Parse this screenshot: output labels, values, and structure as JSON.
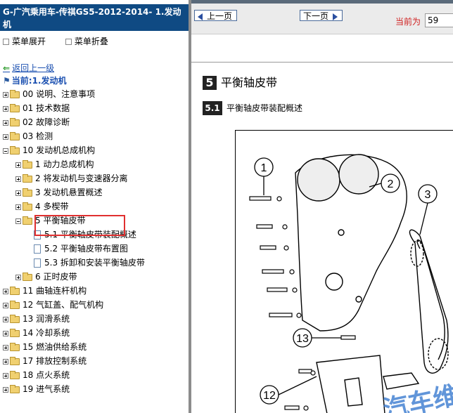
{
  "left_panel": {
    "title": "G-广汽乘用车-传祺GS5-2012-2014- 1.发动机",
    "menu_expand": "菜单展开",
    "menu_collapse": "菜单折叠",
    "back_link": "返回上一级",
    "current": "当前:1.发动机"
  },
  "tree": [
    {
      "label": "00 说明、注意事项",
      "level": 0,
      "type": "folder",
      "expanded": false
    },
    {
      "label": "01 技术数据",
      "level": 0,
      "type": "folder",
      "expanded": false
    },
    {
      "label": "02 故障诊断",
      "level": 0,
      "type": "folder",
      "expanded": false
    },
    {
      "label": "03 检测",
      "level": 0,
      "type": "folder",
      "expanded": false
    },
    {
      "label": "10 发动机总成机构",
      "level": 0,
      "type": "folder",
      "expanded": true
    },
    {
      "label": "1 动力总成机构",
      "level": 1,
      "type": "folder",
      "expanded": false
    },
    {
      "label": "2 将发动机与变速器分离",
      "level": 1,
      "type": "folder",
      "expanded": false
    },
    {
      "label": "3 发动机悬置概述",
      "level": 1,
      "type": "folder",
      "expanded": false
    },
    {
      "label": "4 多楔带",
      "level": 1,
      "type": "folder",
      "expanded": false
    },
    {
      "label": "5 平衡轴皮带",
      "level": 1,
      "type": "folder",
      "expanded": true
    },
    {
      "label": "5.1 平衡轴皮带装配概述",
      "level": 2,
      "type": "doc"
    },
    {
      "label": "5.2 平衡轴皮带布置图",
      "level": 2,
      "type": "doc"
    },
    {
      "label": "5.3 拆卸和安装平衡轴皮带",
      "level": 2,
      "type": "doc"
    },
    {
      "label": "6 正时皮带",
      "level": 1,
      "type": "folder",
      "expanded": false
    },
    {
      "label": "11 曲轴连杆机构",
      "level": 0,
      "type": "folder",
      "expanded": false
    },
    {
      "label": "12 气缸盖、配气机构",
      "level": 0,
      "type": "folder",
      "expanded": false
    },
    {
      "label": "13 润滑系统",
      "level": 0,
      "type": "folder",
      "expanded": false
    },
    {
      "label": "14 冷却系统",
      "level": 0,
      "type": "folder",
      "expanded": false
    },
    {
      "label": "15 燃油供给系统",
      "level": 0,
      "type": "folder",
      "expanded": false
    },
    {
      "label": "17 排放控制系统",
      "level": 0,
      "type": "folder",
      "expanded": false
    },
    {
      "label": "18 点火系统",
      "level": 0,
      "type": "folder",
      "expanded": false
    },
    {
      "label": "19 进气系统",
      "level": 0,
      "type": "folder",
      "expanded": false
    }
  ],
  "toolbar": {
    "prev_label": "上一页",
    "next_label": "下一页",
    "current_page_label": "当前为",
    "current_page_value": "59"
  },
  "content": {
    "section_num": "5",
    "section_title": "平衡轴皮带",
    "subsection_num": "5.1",
    "subsection_title": "平衡轴皮带装配概述"
  },
  "diagram": {
    "callouts": [
      "1",
      "2",
      "3",
      "13",
      "12"
    ],
    "watermark": "汽车维"
  },
  "colors": {
    "header_bg": "#0f4a83",
    "link": "#1a4fb0",
    "highlight_box": "#e03030",
    "current_page_text": "#d02020"
  }
}
